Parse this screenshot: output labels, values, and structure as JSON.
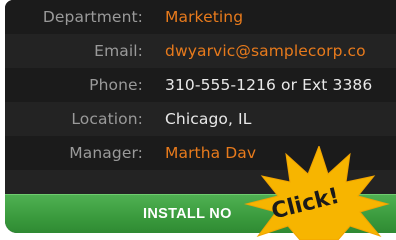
{
  "contact_card": {
    "rows": [
      {
        "label": "Department:",
        "value": "Marketing",
        "style": "link"
      },
      {
        "label": "Email:",
        "value": "dwyarvic@samplecorp.co",
        "style": "link"
      },
      {
        "label": "Phone:",
        "value": "310-555-1216 or Ext 3386",
        "style": "plain"
      },
      {
        "label": "Location:",
        "value": "Chicago, IL",
        "style": "plain"
      },
      {
        "label": "Manager:",
        "value": "Martha Dav",
        "style": "link"
      }
    ]
  },
  "install_button": {
    "label": "INSTALL NO"
  },
  "callout": {
    "text": "Click!"
  },
  "colors": {
    "link": "#e77a1c",
    "install_green": "#3a9a3d",
    "burst_fill": "#f7b500"
  }
}
